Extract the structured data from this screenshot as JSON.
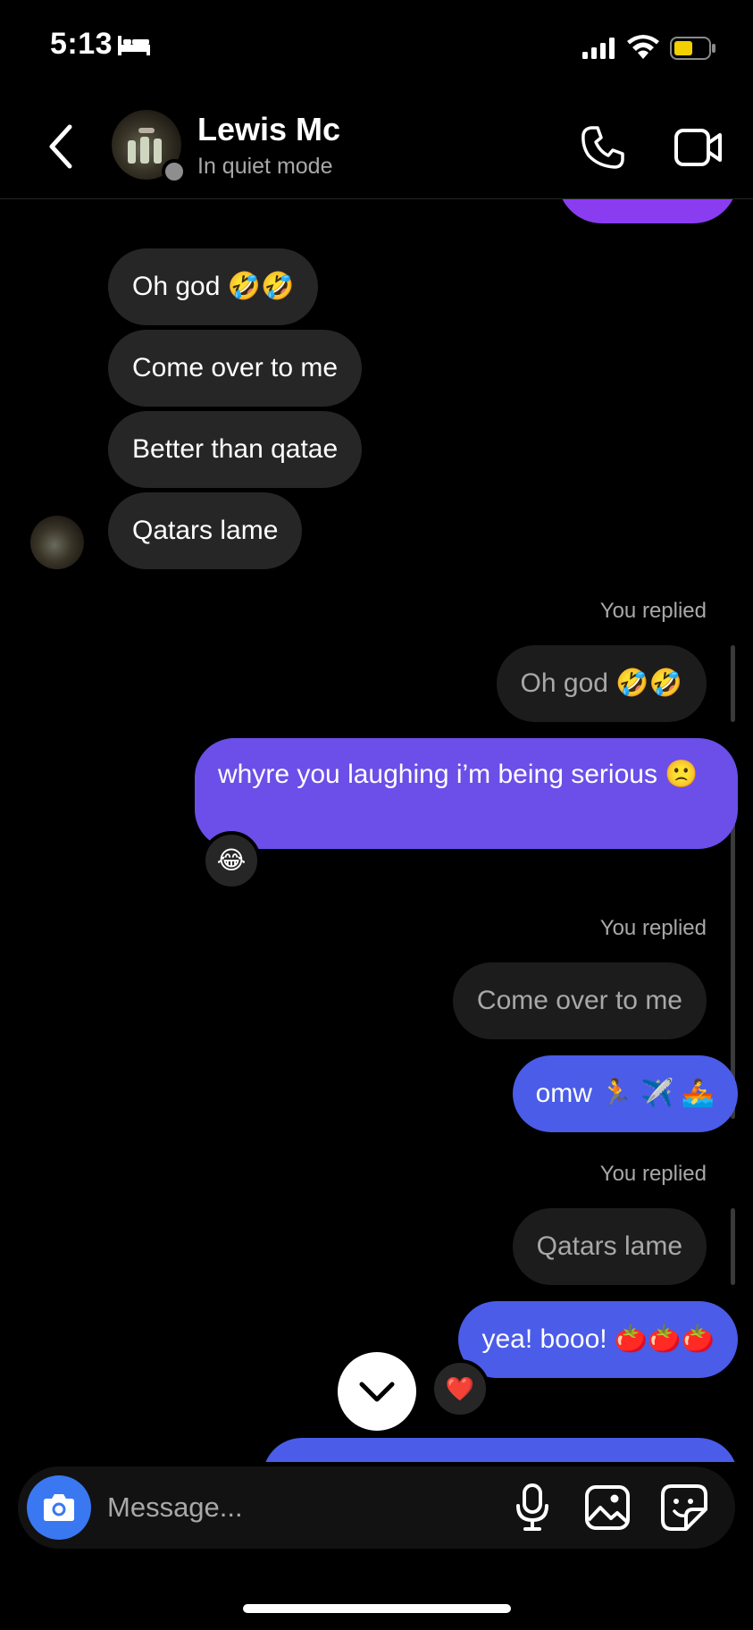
{
  "status_bar": {
    "time": "5:13"
  },
  "header": {
    "name": "Lewis Mc",
    "status": "In quiet mode"
  },
  "messages": [
    {
      "text": "Oh god 🤣🤣"
    },
    {
      "text": "Come over to me"
    },
    {
      "text": "Better than qatae"
    },
    {
      "text": "Qatars lame"
    }
  ],
  "replies": [
    {
      "label": "You replied",
      "quoted": "Oh god 🤣🤣",
      "text": "whyre you laughing i’m being serious 🙁",
      "reaction": "😂"
    },
    {
      "label": "You replied",
      "quoted": "Come over to me",
      "text": "omw 🏃 ✈️ 🚣"
    },
    {
      "label": "You replied",
      "quoted": "Qatars lame",
      "text": "yea! booo! 🍅🍅🍅",
      "reaction": "❤️"
    }
  ],
  "composer": {
    "placeholder": "Message..."
  },
  "colors": {
    "outgoing_blue": "#4a5ce8",
    "outgoing_purple": "#6b4fe8",
    "incoming": "#262626",
    "camera_button": "#3a78f2"
  },
  "icons": [
    "bed-icon",
    "signal-icon",
    "wifi-icon",
    "battery-icon",
    "back-icon",
    "phone-icon",
    "video-camera-icon",
    "chevron-down-icon",
    "camera-icon",
    "microphone-icon",
    "gallery-icon",
    "sticker-icon"
  ]
}
